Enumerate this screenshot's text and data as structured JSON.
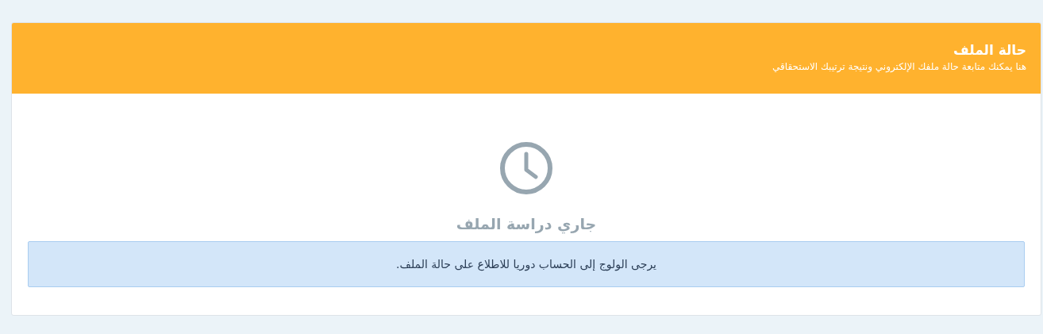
{
  "panel": {
    "title": "حالة الملف",
    "subtitle": "هنا يمكنك متابعة حالة ملفك الإلكتروني ونتيجة ترتيبك الاستحقاقي"
  },
  "status": {
    "kind": "pending",
    "label": "جاري دراسة الملف"
  },
  "alert": {
    "kind": "info",
    "text": "يرجى الولوج إلى الحساب دوريا للاطلاع على حالة الملف."
  }
}
